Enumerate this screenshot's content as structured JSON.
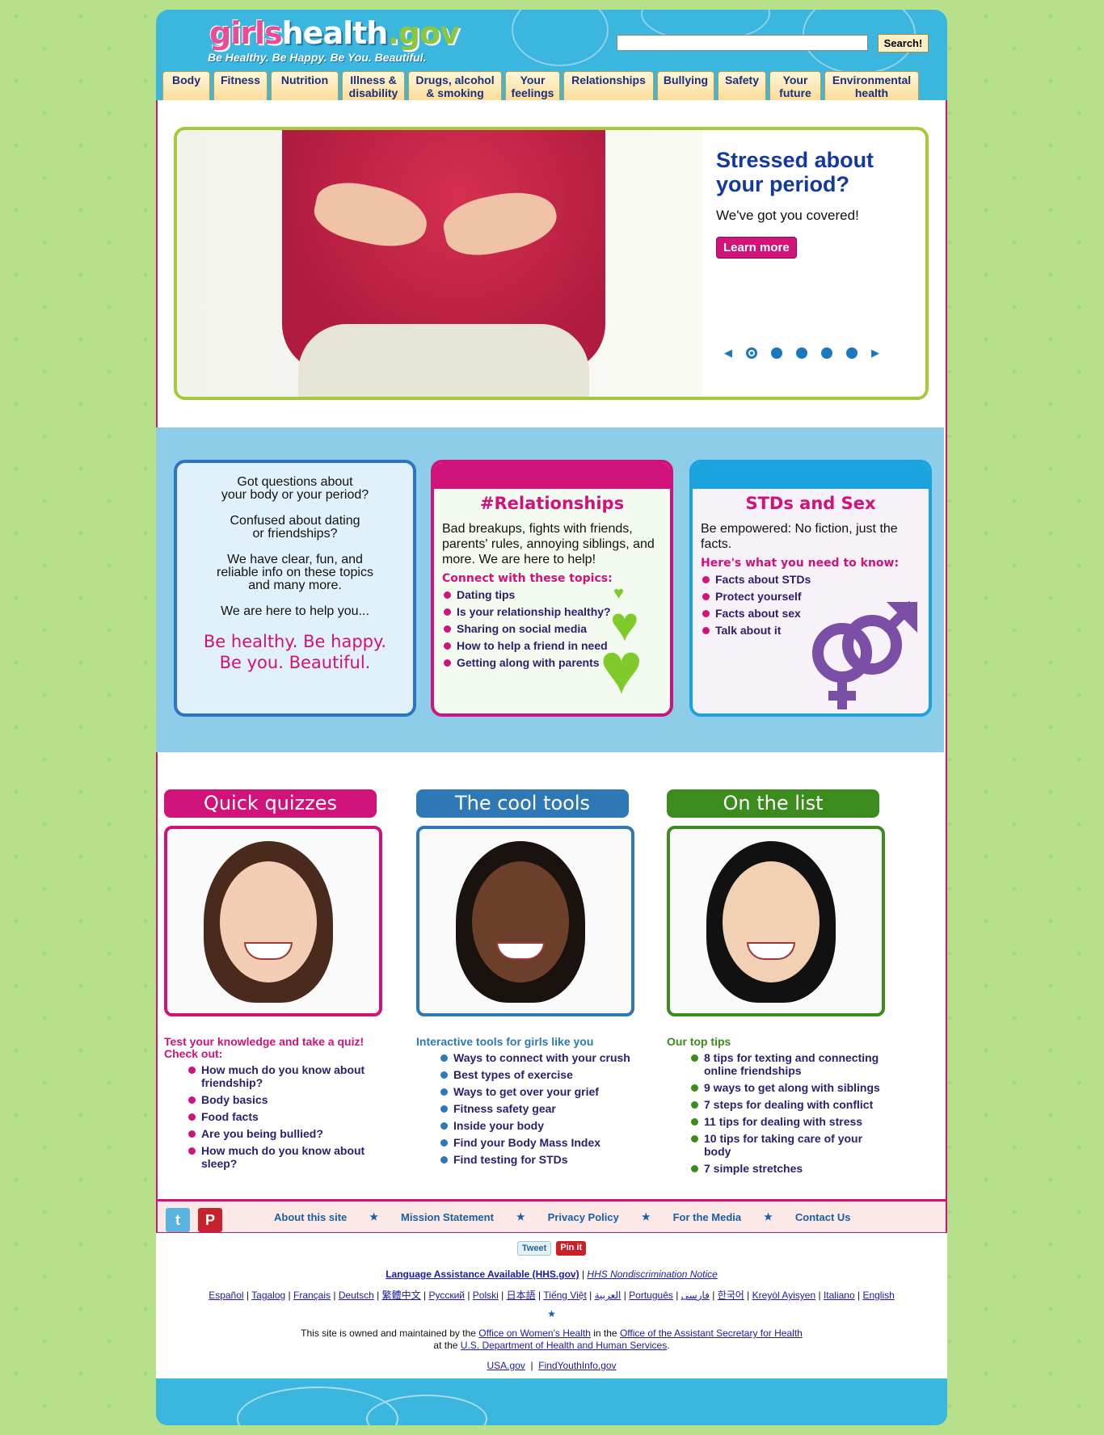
{
  "header": {
    "logo": {
      "part1": "girls",
      "part2": "health",
      "part3": ".gov"
    },
    "tagline": "Be Healthy. Be Happy. Be You. Beautiful.",
    "search_button": "Search!",
    "colors": {
      "header_bg": "#3bb6df",
      "accent_pink": "#d0127a",
      "accent_green": "#8cc63f",
      "nav_text": "#1b2f7a"
    }
  },
  "nav": [
    {
      "l1": "Body",
      "l2": ""
    },
    {
      "l1": "Fitness",
      "l2": ""
    },
    {
      "l1": "Nutrition",
      "l2": ""
    },
    {
      "l1": "Illness &",
      "l2": "disability"
    },
    {
      "l1": "Drugs, alcohol",
      "l2": "& smoking"
    },
    {
      "l1": "Your",
      "l2": "feelings"
    },
    {
      "l1": "Relationships",
      "l2": ""
    },
    {
      "l1": "Bullying",
      "l2": ""
    },
    {
      "l1": "Safety",
      "l2": ""
    },
    {
      "l1": "Your",
      "l2": "future"
    },
    {
      "l1": "Environmental",
      "l2": "health"
    }
  ],
  "hero": {
    "title": "Stressed about your period?",
    "subtitle": "We've got you covered!",
    "button": "Learn more",
    "slide_count": 5,
    "active_slide": 1
  },
  "card1": {
    "q1a": "Got questions about",
    "q1b": "your body or your period?",
    "q2a": "Confused about dating",
    "q2b": "or friendships?",
    "q3a": "We have clear, fun, and",
    "q3b": "reliable info on these topics",
    "q3c": "and many more.",
    "q4": "We are here to help you...",
    "slogan1": "Be healthy. Be happy.",
    "slogan2": "Be you. Beautiful."
  },
  "card2": {
    "title": "#Relationships",
    "text": "Bad breakups, fights with friends, parents' rules, annoying siblings, and more. We are here to help!",
    "subhead": "Connect with these topics:",
    "items": [
      "Dating tips",
      "Is your relationship healthy?",
      "Sharing on social media",
      "How to help a friend in need",
      "Getting along with parents"
    ]
  },
  "card3": {
    "title": "STDs and Sex",
    "text": "Be empowered: No fiction, just the facts.",
    "subhead": "Here's what you need to know:",
    "items": [
      "Facts about STDs",
      "Protect yourself",
      "Facts about sex",
      "Talk about it"
    ]
  },
  "features": [
    {
      "title": "Quick quizzes",
      "intro": "Test your knowledge and take a quiz! Check out:",
      "color": "#d0127a",
      "items": [
        "How much do you know about friendship?",
        "Body basics",
        "Food facts",
        "Are you being bullied?",
        "How much do you know about sleep?"
      ]
    },
    {
      "title": "The cool tools",
      "intro": "Interactive tools for girls like you",
      "color": "#2f78b6",
      "items": [
        "Ways to connect with your crush",
        "Best types of exercise",
        "Ways to get over your grief",
        "Fitness safety gear",
        "Inside your body",
        "Find your Body Mass Index",
        "Find testing for STDs"
      ]
    },
    {
      "title": "On the list",
      "intro": "Our top tips",
      "color": "#3b8c1c",
      "items": [
        "8 tips for texting and connecting online friendships",
        "9 ways to get along with siblings",
        "7 steps for dealing with conflict",
        "11 tips for dealing with stress",
        "10 tips for taking care of your body",
        "7 simple stretches"
      ]
    }
  ],
  "footer_links": [
    "About this site",
    "Mission Statement",
    "Privacy Policy",
    "For the Media",
    "Contact Us"
  ],
  "share": {
    "tweet": "Tweet",
    "pin": "Pin it"
  },
  "language": {
    "assist": "Language Assistance Available (HHS.gov)",
    "notice": "HHS Nondiscrimination Notice"
  },
  "languages": [
    "Español",
    "Tagalog",
    "Français",
    "Deutsch",
    "繁體中文",
    "Русский",
    "Polski",
    "日本語",
    "Tiếng Việt",
    "العربية",
    "Português",
    "فارسی",
    "한국어",
    "Kreyòl Ayisyen",
    "Italiano",
    "English"
  ],
  "owner": {
    "t1": "This site is owned and maintained by the",
    "l1": "Office on Women's Health",
    "t2": "in the",
    "l2": "Office of the Assistant Secretary for Health",
    "t3": "at the",
    "l3": "U.S. Department of Health and Human Services",
    "t4": "."
  },
  "bottom_links": [
    "USA.gov",
    "FindYouthInfo.gov"
  ]
}
